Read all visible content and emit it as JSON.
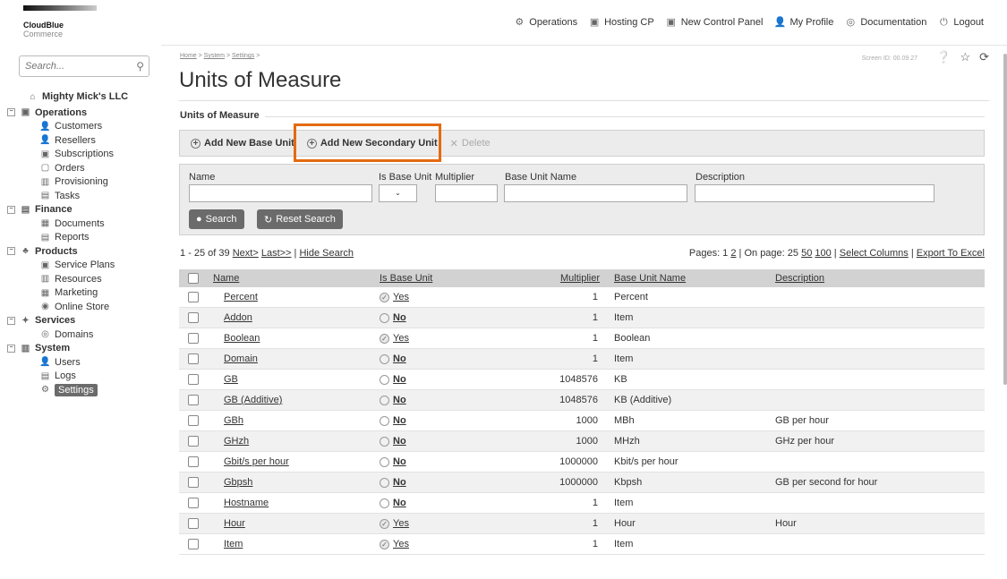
{
  "brand": {
    "line1": "CloudBlue",
    "line2": "Commerce"
  },
  "topnav": [
    {
      "label": "Operations",
      "icon": "operations-icon",
      "glyph": "⚙"
    },
    {
      "label": "Hosting CP",
      "icon": "hosting-cp-icon",
      "glyph": "▣"
    },
    {
      "label": "New Control Panel",
      "icon": "control-panel-icon",
      "glyph": "▣"
    },
    {
      "label": "My Profile",
      "icon": "profile-icon",
      "glyph": "👤"
    },
    {
      "label": "Documentation",
      "icon": "documentation-icon",
      "glyph": "◎"
    },
    {
      "label": "Logout",
      "icon": "logout-icon",
      "glyph": "⏻"
    }
  ],
  "search": {
    "placeholder": "Search..."
  },
  "sidebar": {
    "company": "Mighty Mick's LLC",
    "groups": [
      {
        "label": "Operations",
        "items": [
          "Customers",
          "Resellers",
          "Subscriptions",
          "Orders",
          "Provisioning",
          "Tasks"
        ]
      },
      {
        "label": "Finance",
        "items": [
          "Documents",
          "Reports"
        ]
      },
      {
        "label": "Products",
        "items": [
          "Service Plans",
          "Resources",
          "Marketing",
          "Online Store"
        ]
      },
      {
        "label": "Services",
        "items": [
          "Domains"
        ]
      },
      {
        "label": "System",
        "items": [
          "Users",
          "Logs",
          "Settings"
        ]
      }
    ],
    "selected": "Settings"
  },
  "breadcrumbs": [
    "Home",
    "System",
    "Settings"
  ],
  "screen_id": "Screen ID: 00.09.27",
  "page_title": "Units of Measure",
  "section_title": "Units of Measure",
  "toolbar": {
    "add_base": "Add New Base Unit",
    "add_secondary": "Add New Secondary Unit",
    "delete": "Delete"
  },
  "filter": {
    "name_label": "Name",
    "is_base_label": "Is Base Unit",
    "multiplier_label": "Multiplier",
    "base_name_label": "Base Unit Name",
    "description_label": "Description",
    "search_btn": "Search",
    "reset_btn": "Reset Search"
  },
  "pager": {
    "range": "1 - 25 of 39",
    "next": "Next>",
    "last": "Last>>",
    "hide": "Hide Search",
    "pages_label": "Pages: 1",
    "page2": "2",
    "on_page": "| On page: 25",
    "opt50": "50",
    "opt100": "100",
    "select_columns": "Select Columns",
    "export": "Export To Excel"
  },
  "table": {
    "headers": [
      "Name",
      "Is Base Unit",
      "Multiplier",
      "Base Unit Name",
      "Description"
    ],
    "rows": [
      {
        "name": "Percent",
        "base": "Yes",
        "mult": "1",
        "base_name": "Percent",
        "desc": ""
      },
      {
        "name": "Addon",
        "base": "No",
        "mult": "1",
        "base_name": "Item",
        "desc": ""
      },
      {
        "name": "Boolean",
        "base": "Yes",
        "mult": "1",
        "base_name": "Boolean",
        "desc": ""
      },
      {
        "name": "Domain",
        "base": "No",
        "mult": "1",
        "base_name": "Item",
        "desc": ""
      },
      {
        "name": "GB",
        "base": "No",
        "mult": "1048576",
        "base_name": "KB",
        "desc": ""
      },
      {
        "name": "GB (Additive)",
        "base": "No",
        "mult": "1048576",
        "base_name": "KB (Additive)",
        "desc": ""
      },
      {
        "name": "GBh",
        "base": "No",
        "mult": "1000",
        "base_name": "MBh",
        "desc": "GB per hour"
      },
      {
        "name": "GHzh",
        "base": "No",
        "mult": "1000",
        "base_name": "MHzh",
        "desc": "GHz per hour"
      },
      {
        "name": "Gbit/s per hour",
        "base": "No",
        "mult": "1000000",
        "base_name": "Kbit/s per hour",
        "desc": ""
      },
      {
        "name": "Gbpsh",
        "base": "No",
        "mult": "1000000",
        "base_name": "Kbpsh",
        "desc": "GB per second for hour"
      },
      {
        "name": "Hostname",
        "base": "No",
        "mult": "1",
        "base_name": "Item",
        "desc": ""
      },
      {
        "name": "Hour",
        "base": "Yes",
        "mult": "1",
        "base_name": "Hour",
        "desc": "Hour"
      },
      {
        "name": "Item",
        "base": "Yes",
        "mult": "1",
        "base_name": "Item",
        "desc": ""
      }
    ]
  },
  "colors": {
    "highlight": "#e46a10",
    "selected_bg": "#6b6b6b",
    "header_bg": "#d2d2d2"
  }
}
